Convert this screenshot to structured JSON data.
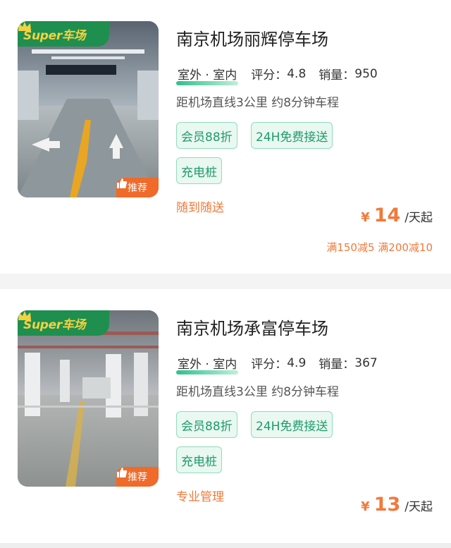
{
  "lots": [
    {
      "badge": "Super车场",
      "recommend": "推荐",
      "name": "南京机场丽辉停车场",
      "type": "室外 · 室内",
      "rating_label": "评分：",
      "rating": "4.8",
      "sales_label": "销量：",
      "sales": "950",
      "distance": "距机场直线3公里 约8分钟车程",
      "chips": [
        "会员88折",
        "24H免费接送",
        "充电桩"
      ],
      "service": "随到随送",
      "currency": "¥",
      "price": "14",
      "price_unit": "/天起",
      "promo": "满150减5 满200减10"
    },
    {
      "badge": "Super车场",
      "recommend": "推荐",
      "name": "南京机场承富停车场",
      "type": "室外 · 室内",
      "rating_label": "评分：",
      "rating": "4.9",
      "sales_label": "销量：",
      "sales": "367",
      "distance": "距机场直线3公里 约8分钟车程",
      "chips": [
        "会员88折",
        "24H免费接送",
        "充电桩"
      ],
      "service": "专业管理",
      "currency": "¥",
      "price": "13",
      "price_unit": "/天起"
    }
  ],
  "colors": {
    "brand_green": "#1e8f4e",
    "accent_orange": "#f07a3c",
    "chip_green": "#1f9b6b"
  }
}
